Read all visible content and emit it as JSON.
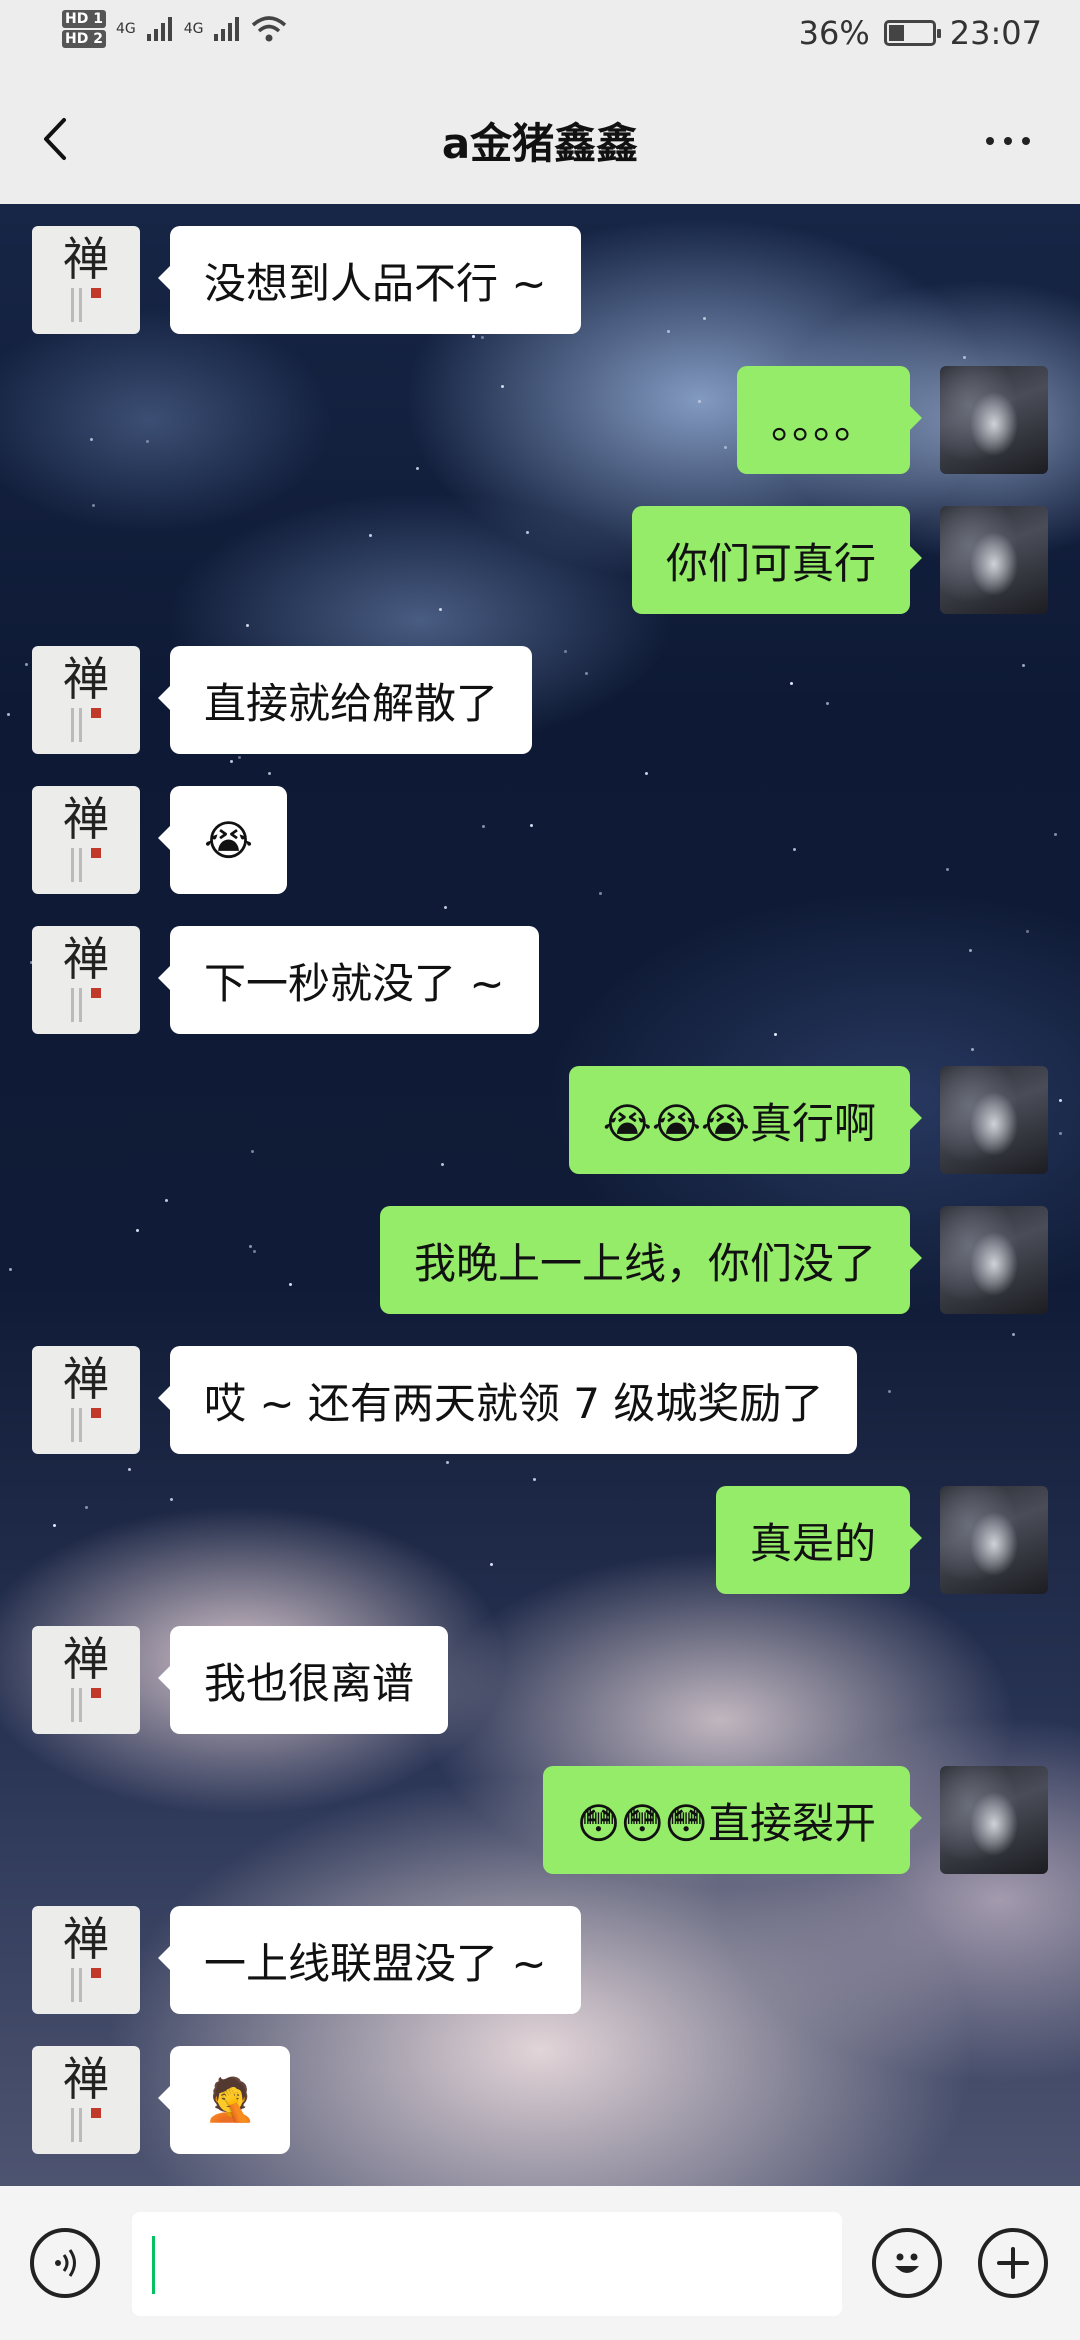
{
  "status_bar": {
    "hd1": "HD 1",
    "hd2": "HD 2",
    "net1": "4G",
    "net2": "4G",
    "battery_percent": "36%",
    "battery_level": 0.36,
    "time": "23:07"
  },
  "header": {
    "back_icon": "chevron-left-icon",
    "title": "a金猪鑫鑫",
    "more_icon": "more-horizontal-icon"
  },
  "messages": [
    {
      "side": "left",
      "text": "没想到人品不行 ~"
    },
    {
      "side": "right",
      "text": "。。。。"
    },
    {
      "side": "right",
      "text": "你们可真行"
    },
    {
      "side": "left",
      "text": "直接就给解散了"
    },
    {
      "side": "left",
      "text": "😭"
    },
    {
      "side": "left",
      "text": "下一秒就没了 ~"
    },
    {
      "side": "right",
      "text": "😭😭😭真行啊"
    },
    {
      "side": "right",
      "text": "我晚上一上线，你们没了"
    },
    {
      "side": "left",
      "text": "哎 ~ 还有两天就领 7 级城奖励了"
    },
    {
      "side": "right",
      "text": "真是的"
    },
    {
      "side": "left",
      "text": "我也很离谱"
    },
    {
      "side": "right",
      "text": "😳😳😳直接裂开"
    },
    {
      "side": "left",
      "text": "一上线联盟没了 ~"
    },
    {
      "side": "left",
      "text": "🤦"
    }
  ],
  "avatars": {
    "contact_char": "禅"
  },
  "input_bar": {
    "voice_icon": "voice-icon",
    "emoji_icon": "emoji-icon",
    "plus_icon": "plus-icon",
    "text_value": ""
  },
  "colors": {
    "sent_bubble": "#95ec69",
    "received_bubble": "#ffffff",
    "bar_background": "#ededed",
    "caret": "#07c160"
  }
}
